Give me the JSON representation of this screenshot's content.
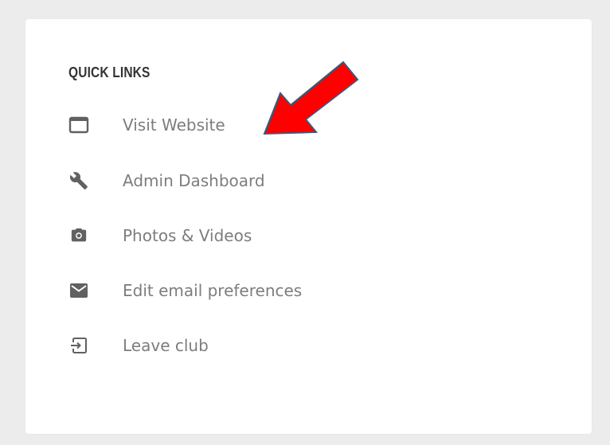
{
  "quick_links": {
    "title": "QUICK LINKS",
    "items": [
      {
        "label": "Visit Website",
        "icon": "browser-window-icon"
      },
      {
        "label": "Admin Dashboard",
        "icon": "wrench-icon"
      },
      {
        "label": "Photos & Videos",
        "icon": "camera-icon"
      },
      {
        "label": "Edit email preferences",
        "icon": "envelope-icon"
      },
      {
        "label": "Leave club",
        "icon": "exit-icon"
      }
    ]
  },
  "colors": {
    "background": "#ececec",
    "card": "#ffffff",
    "title": "#333333",
    "link_text": "#7d7d7d",
    "icon": "#616161",
    "annotation_arrow": "#ff0000"
  }
}
